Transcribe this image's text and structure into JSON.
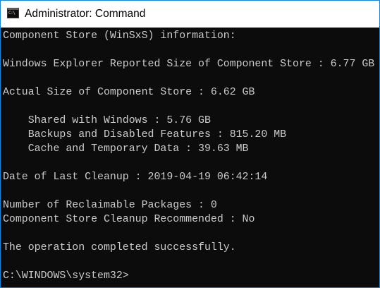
{
  "window": {
    "title": "Administrator: Command",
    "icon": "cmd-icon",
    "icon_text": "C:\\"
  },
  "console": {
    "lines": [
      "Component Store (WinSxS) information:",
      "",
      "Windows Explorer Reported Size of Component Store : 6.77 GB",
      "",
      "Actual Size of Component Store : 6.62 GB",
      "",
      "    Shared with Windows : 5.76 GB",
      "    Backups and Disabled Features : 815.20 MB",
      "    Cache and Temporary Data : 39.63 MB",
      "",
      "Date of Last Cleanup : 2019-04-19 06:42:14",
      "",
      "Number of Reclaimable Packages : 0",
      "Component Store Cleanup Recommended : No",
      "",
      "The operation completed successfully.",
      "",
      "C:\\WINDOWS\\system32>"
    ]
  },
  "colors": {
    "background": "#0c0c0c",
    "text": "#cccccc",
    "titlebar": "#ffffff",
    "border": "#1883d7"
  }
}
